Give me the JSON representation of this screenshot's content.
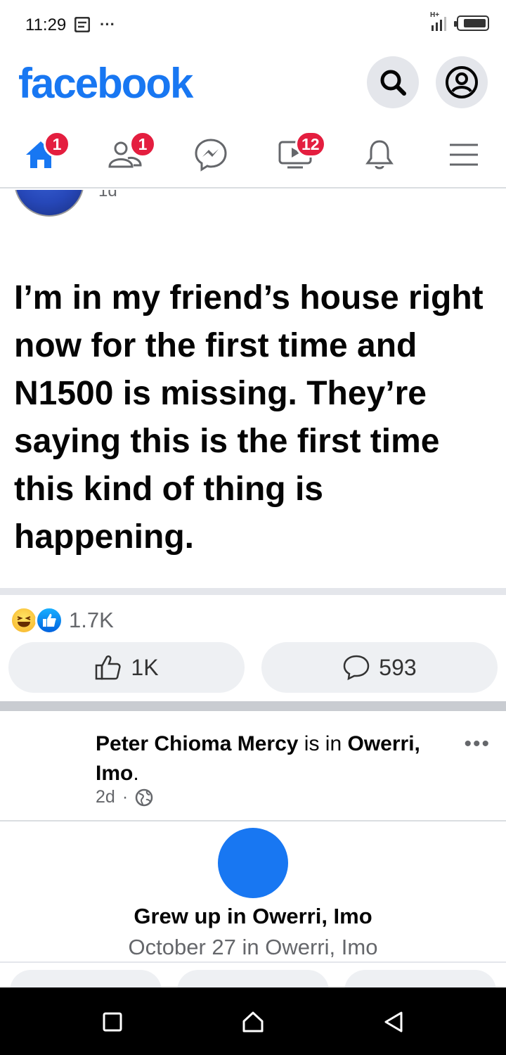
{
  "status_bar": {
    "time": "11:29",
    "more": "···",
    "network": "H+"
  },
  "header": {
    "logo": "facebook",
    "search_icon": "search-icon",
    "profile_icon": "profile-icon",
    "brand_color": "#1877f2"
  },
  "nav": {
    "home_badge": "1",
    "friends_badge": "1",
    "watch_badge": "12"
  },
  "post": {
    "time": "1d",
    "text": "I’m in my friend’s house right now for the first time and N1500 is missing. They’re saying this is the first time this kind of thing is happening.",
    "reaction_count": "1.7K",
    "like_count": "1K",
    "comment_count": "593"
  },
  "post2": {
    "author": "Peter Chioma Mercy",
    "is_in": " is in ",
    "place_line1": "Owerri,",
    "place_line2": "Imo",
    "period": ".",
    "time": "2d",
    "dot": "·",
    "more": "•••",
    "life_event_title": "Grew up in Owerri, Imo",
    "life_event_sub": "October 27 in Owerri, Imo"
  }
}
